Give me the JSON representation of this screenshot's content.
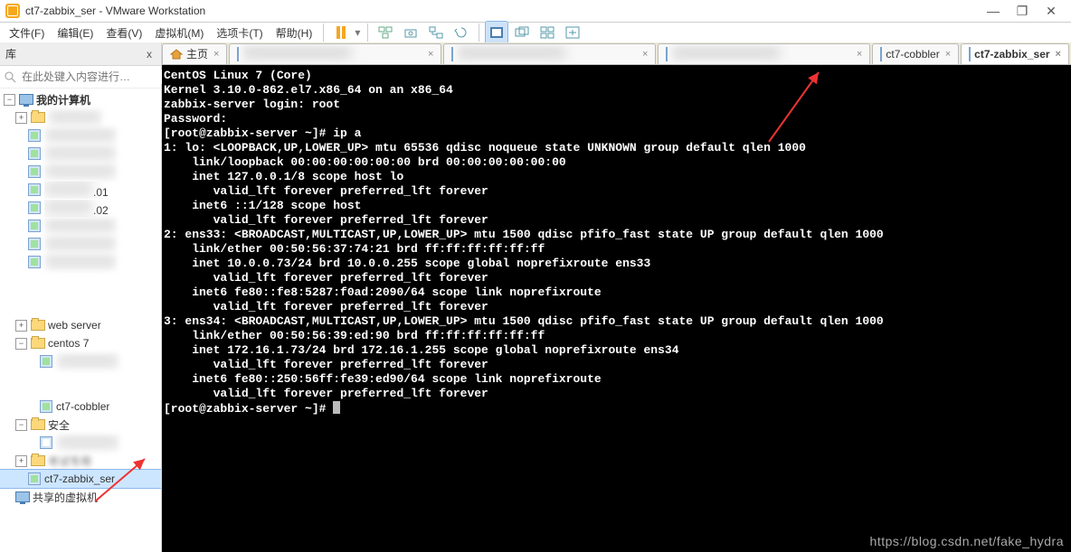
{
  "window": {
    "title": "ct7-zabbix_ser - VMware Workstation",
    "min": "—",
    "restore": "❐",
    "close": "✕"
  },
  "menu": {
    "file": "文件(F)",
    "edit": "编辑(E)",
    "view": "查看(V)",
    "vm": "虚拟机(M)",
    "tabs": "选项卡(T)",
    "help": "帮助(H)"
  },
  "toolbar_icons": {
    "history": "history",
    "play": "play/pause",
    "drop": "▾",
    "power_on": "power-on-icon",
    "snapshot": "snapshot-icon",
    "snap_mgr": "snap-mgr-icon",
    "unity": "unity-icon",
    "full": "fullscreen-icon",
    "multi": "multimon-icon",
    "fit": "fit-icon",
    "stretch": "stretch-icon"
  },
  "sidebar": {
    "title": "库",
    "close": "x",
    "search_placeholder": "在此处键入内容进行…",
    "root": "我的计算机",
    "hidden": [
      ".",
      ".",
      ".",
      ".01",
      ".02",
      ".",
      ".",
      "."
    ],
    "web_server": "web server",
    "centos": "centos 7",
    "c7items": [
      ".",
      "."
    ],
    "cobbler": "ct7-cobbler",
    "sec": "安全",
    "sec_items": [
      "."
    ],
    "kaoshi": "考试专用",
    "zabbix": "ct7-zabbix_ser",
    "shared": "共享的虚拟机"
  },
  "tabs": {
    "home": "主页",
    "cobbler": "ct7-cobbler",
    "zabbix": "ct7-zabbix_ser",
    "close": "×"
  },
  "terminal": [
    {
      "t": "",
      "c": ""
    },
    {
      "t": "CentOS Linux 7 (Core)",
      "c": "bw"
    },
    {
      "t": "Kernel 3.10.0-862.el7.x86_64 on an x86_64",
      "c": "bw"
    },
    {
      "t": "",
      "c": ""
    },
    {
      "t": "zabbix-server login: root",
      "c": "bw"
    },
    {
      "t": "Password:",
      "c": "bw"
    },
    {
      "t": "[root@zabbix-server ~]# ip a",
      "c": "bw"
    },
    {
      "t": "1: lo: <LOOPBACK,UP,LOWER_UP> mtu 65536 qdisc noqueue state UNKNOWN group default qlen 1000",
      "c": "bw"
    },
    {
      "t": "    link/loopback 00:00:00:00:00:00 brd 00:00:00:00:00:00",
      "c": "bw"
    },
    {
      "t": "    inet 127.0.0.1/8 scope host lo",
      "c": "bw"
    },
    {
      "t": "       valid_lft forever preferred_lft forever",
      "c": "bw"
    },
    {
      "t": "    inet6 ::1/128 scope host",
      "c": "bw"
    },
    {
      "t": "       valid_lft forever preferred_lft forever",
      "c": "bw"
    },
    {
      "t": "2: ens33: <BROADCAST,MULTICAST,UP,LOWER_UP> mtu 1500 qdisc pfifo_fast state UP group default qlen 1000",
      "c": "bw"
    },
    {
      "t": "    link/ether 00:50:56:37:74:21 brd ff:ff:ff:ff:ff:ff",
      "c": "bw"
    },
    {
      "t": "    inet 10.0.0.73/24 brd 10.0.0.255 scope global noprefixroute ens33",
      "c": "bw"
    },
    {
      "t": "       valid_lft forever preferred_lft forever",
      "c": "bw"
    },
    {
      "t": "    inet6 fe80::fe8:5287:f0ad:2090/64 scope link noprefixroute",
      "c": "bw"
    },
    {
      "t": "       valid_lft forever preferred_lft forever",
      "c": "bw"
    },
    {
      "t": "3: ens34: <BROADCAST,MULTICAST,UP,LOWER_UP> mtu 1500 qdisc pfifo_fast state UP group default qlen 1000",
      "c": "bw"
    },
    {
      "t": "    link/ether 00:50:56:39:ed:90 brd ff:ff:ff:ff:ff:ff",
      "c": "bw"
    },
    {
      "t": "    inet 172.16.1.73/24 brd 172.16.1.255 scope global noprefixroute ens34",
      "c": "bw"
    },
    {
      "t": "       valid_lft forever preferred_lft forever",
      "c": "bw"
    },
    {
      "t": "    inet6 fe80::250:56ff:fe39:ed90/64 scope link noprefixroute",
      "c": "bw"
    },
    {
      "t": "       valid_lft forever preferred_lft forever",
      "c": "bw"
    },
    {
      "t": "[root@zabbix-server ~]# ",
      "c": "bw",
      "cursor": true
    }
  ],
  "watermark": "https://blog.csdn.net/fake_hydra"
}
